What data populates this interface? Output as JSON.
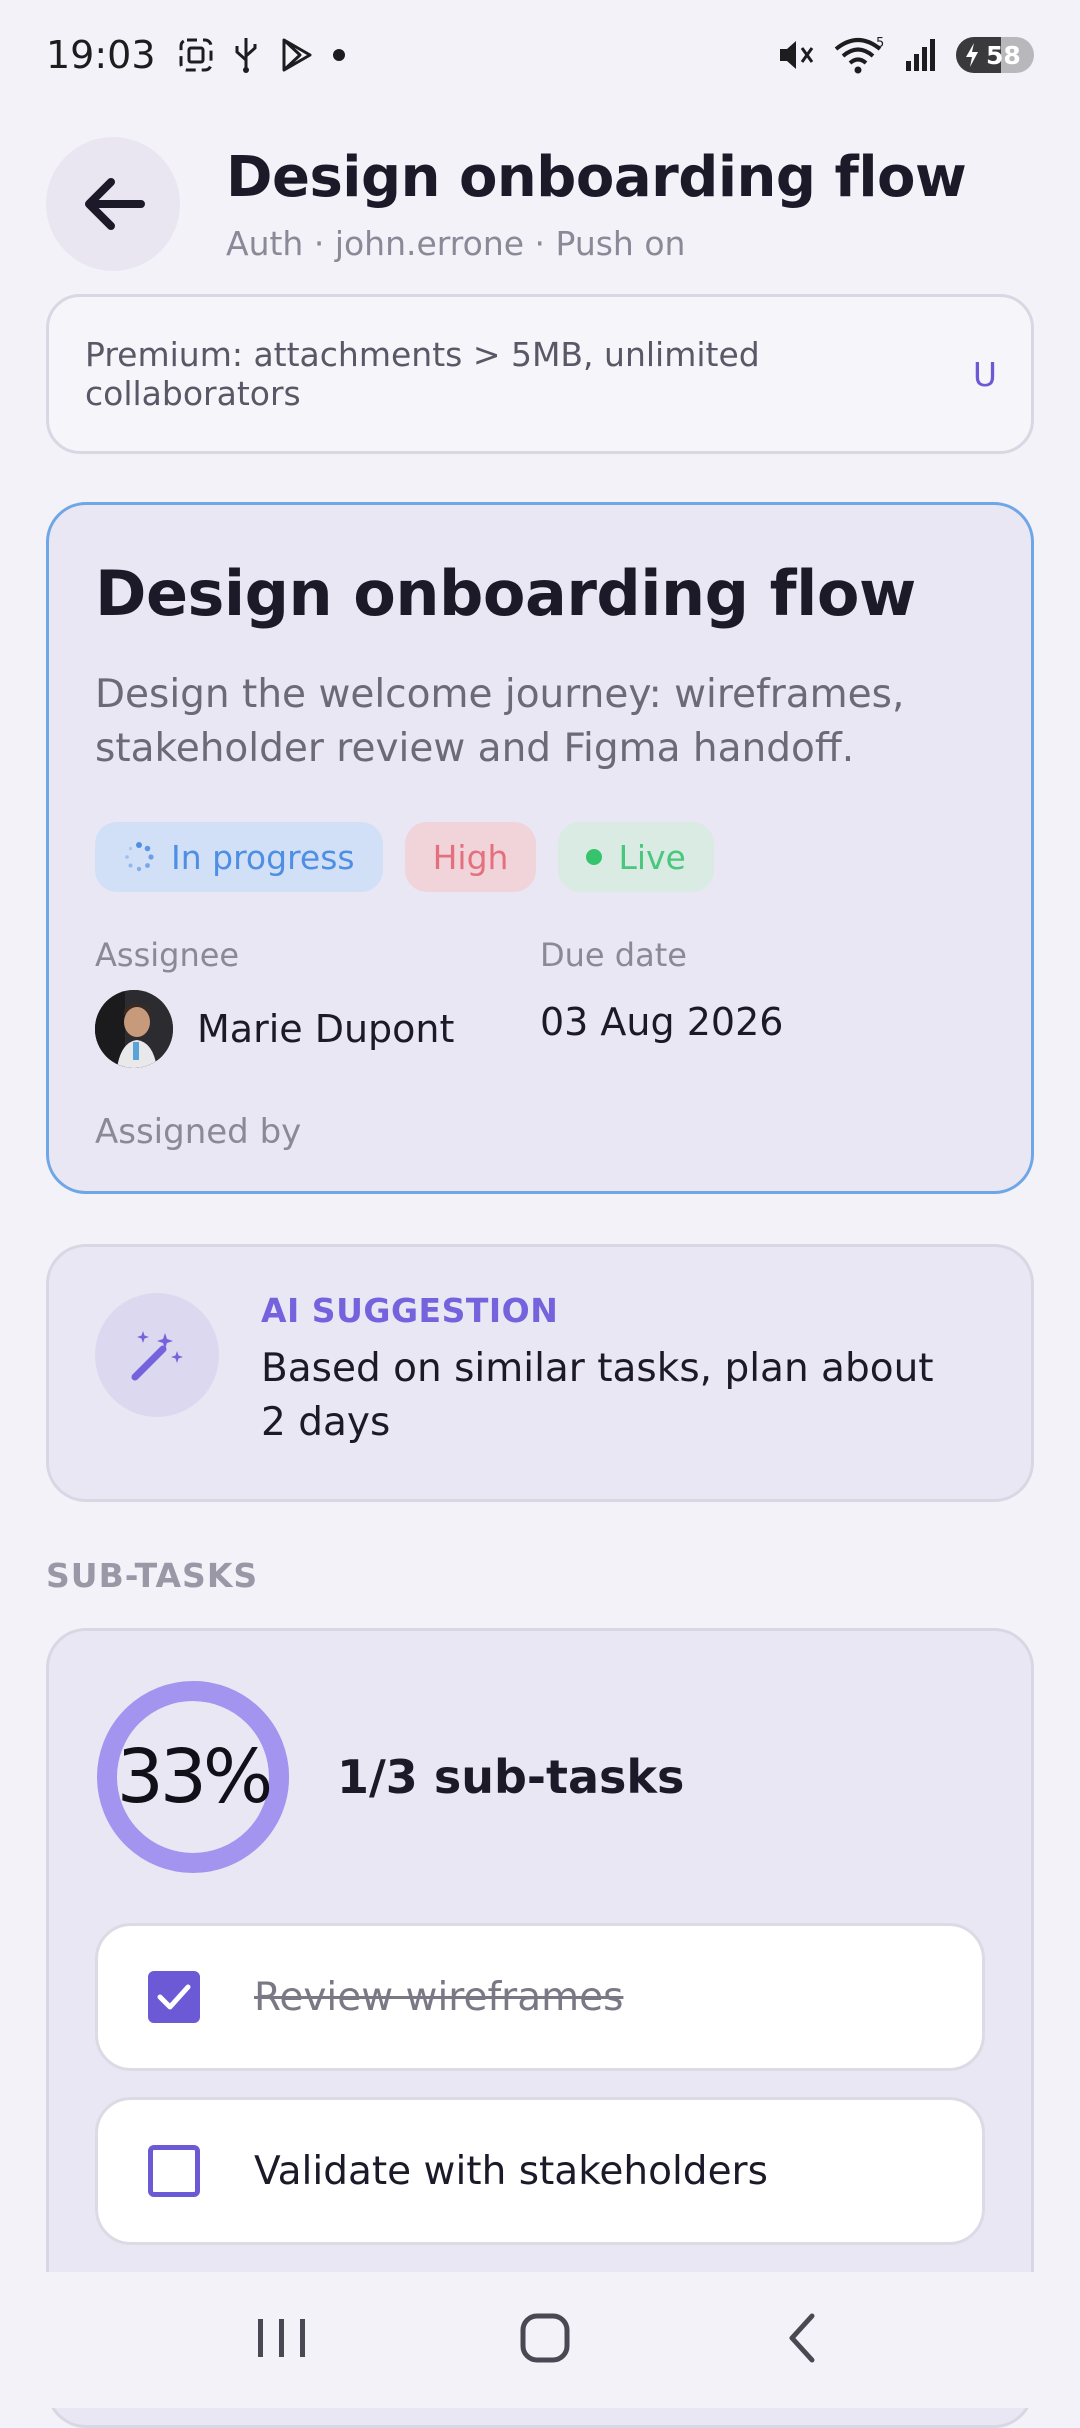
{
  "status_bar": {
    "time": "19:03",
    "battery_level": 58,
    "battery_text": "58",
    "wifi_label": "5"
  },
  "header": {
    "title": "Design onboarding flow",
    "subtitle": "Auth · john.errone · Push on"
  },
  "premium_banner": {
    "text": "Premium: attachments > 5MB, unlimited collaborators",
    "link": "U"
  },
  "task": {
    "title": "Design onboarding flow",
    "description": "Design the welcome journey: wireframes, stakeholder review and Figma handoff.",
    "chips": {
      "status": "In progress",
      "priority": "High",
      "state": "Live"
    },
    "assignee_label": "Assignee",
    "assignee_name": "Marie Dupont",
    "due_label": "Due date",
    "due_date": "03 Aug 2026",
    "assigned_by_label": "Assigned by"
  },
  "ai_suggestion": {
    "label": "AI SUGGESTION",
    "text": "Based on similar tasks, plan about 2 days"
  },
  "subtasks": {
    "section_label": "SUB-TASKS",
    "percent_label": "33%",
    "progress_fraction": 0.33,
    "summary": "1/3 sub-tasks",
    "items": [
      {
        "label": "Review wireframes",
        "done": true
      },
      {
        "label": "Validate with stakeholders",
        "done": false
      }
    ]
  },
  "colors": {
    "accent": "#6c59d6",
    "ring": "#a394f0",
    "card_border_active": "#6fa6e6",
    "chip_progress": "#4f8fe3",
    "chip_high": "#e5707d",
    "chip_live": "#49c77d"
  },
  "icons": {
    "back": "arrow-left-icon",
    "ai": "magic-wand-sparkles-icon",
    "nav_recents": "recents-icon",
    "nav_home": "home-icon",
    "nav_back": "chevron-back-icon"
  }
}
